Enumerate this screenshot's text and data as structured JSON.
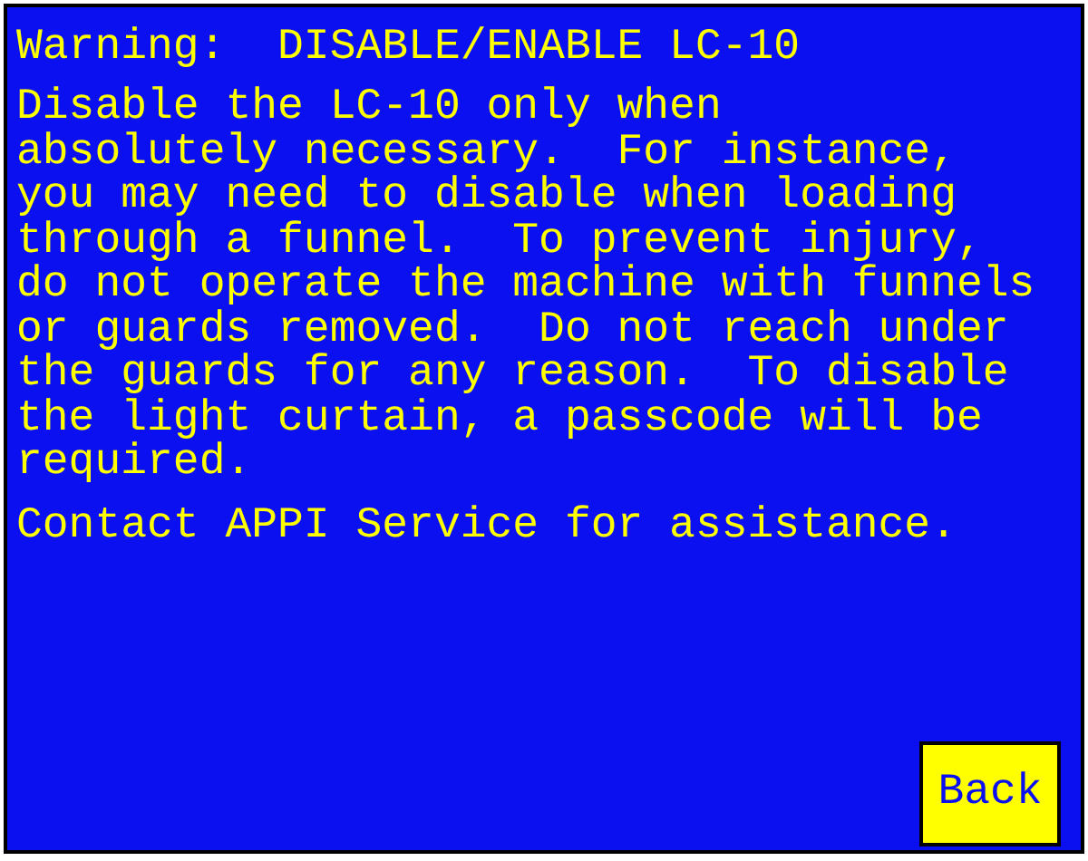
{
  "title": "Warning:  DISABLE/ENABLE LC-10",
  "paragraphs": [
    "Disable the LC-10 only when\nabsolutely necessary.  For instance,\nyou may need to disable when loading\nthrough a funnel.  To prevent injury,\ndo not operate the machine with funnels\nor guards removed.  Do not reach under\nthe guards for any reason.  To disable\nthe light curtain, a passcode will be\nrequired.",
    "Contact APPI Service for assistance."
  ],
  "buttons": [
    "Back"
  ]
}
